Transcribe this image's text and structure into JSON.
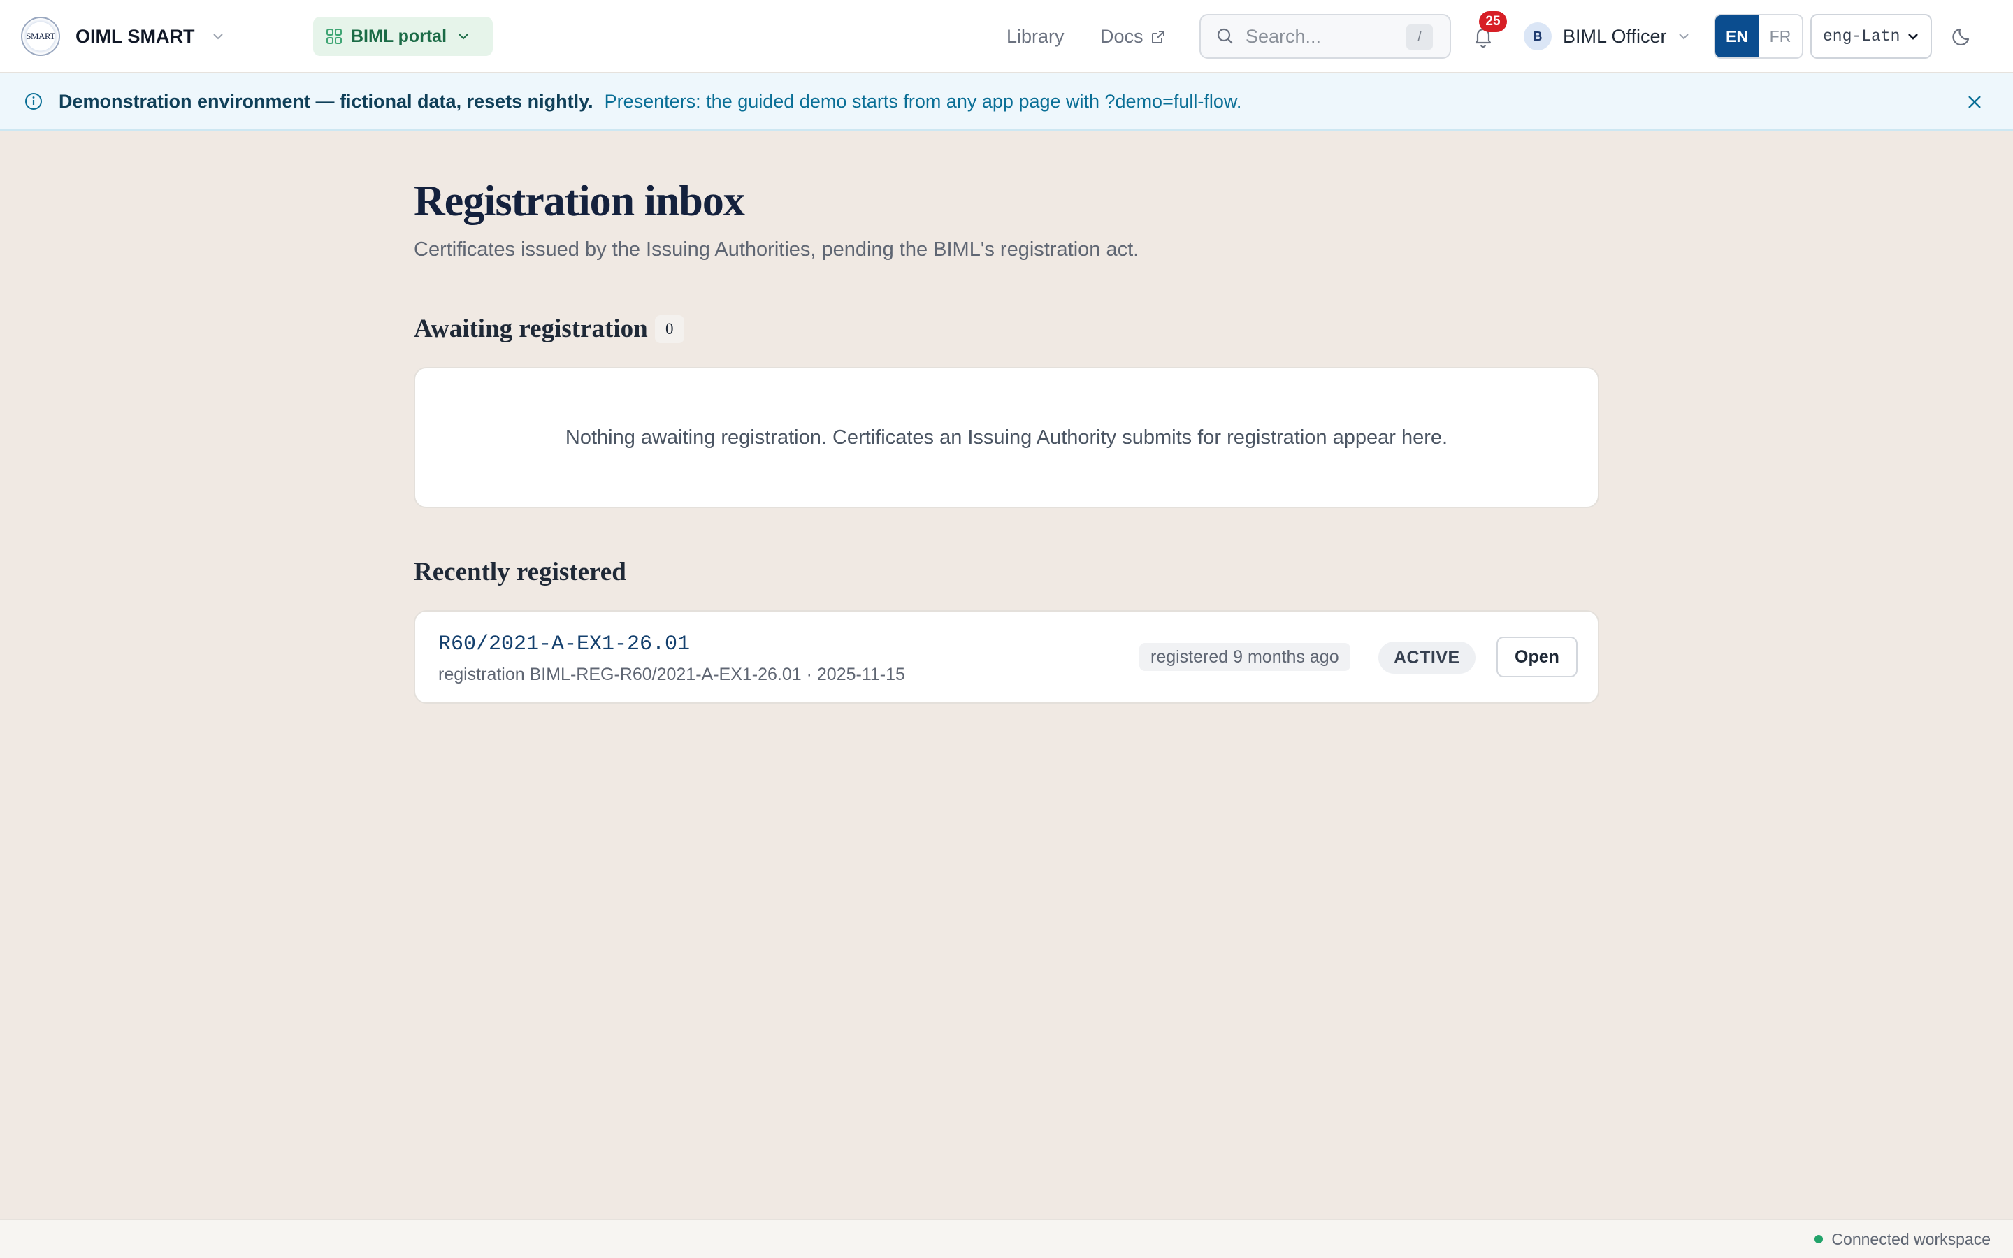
{
  "header": {
    "brand_logo_text": "SMART",
    "brand_name": "OIML SMART",
    "portal_label": "BIML portal",
    "nav": {
      "library": "Library",
      "docs": "Docs"
    },
    "search": {
      "placeholder": "Search...",
      "shortcut": "/"
    },
    "notifications_count": "25",
    "user": {
      "initial": "B",
      "name": "BIML Officer"
    },
    "languages": {
      "en": "EN",
      "fr": "FR",
      "active": "EN"
    },
    "script": {
      "selected": "eng-Latn"
    }
  },
  "banner": {
    "strong": "Demonstration environment — fictional data, resets nightly.",
    "text": "Presenters: the guided demo starts from any app page with ?demo=full-flow."
  },
  "main": {
    "title": "Registration inbox",
    "subtitle": "Certificates issued by the Issuing Authorities, pending the BIML's registration act.",
    "awaiting": {
      "title": "Awaiting registration",
      "count": "0",
      "empty_text": "Nothing awaiting registration. Certificates an Issuing Authority submits for registration appear here."
    },
    "recent": {
      "title": "Recently registered",
      "items": [
        {
          "id": "R60/2021-A-EX1-26.01",
          "meta": "registration BIML-REG-R60/2021-A-EX1-26.01 · 2025-11-15",
          "when": "registered 9 months ago",
          "status": "ACTIVE",
          "action": "Open"
        }
      ]
    }
  },
  "footer": {
    "status": "Connected workspace"
  },
  "colors": {
    "accent": "#0b4d8f",
    "portal_green": "#1b6b46",
    "alert_red": "#d71f26",
    "banner_bg": "#eef7fc",
    "page_bg": "#f0e9e3",
    "connected_dot": "#22a36a"
  }
}
